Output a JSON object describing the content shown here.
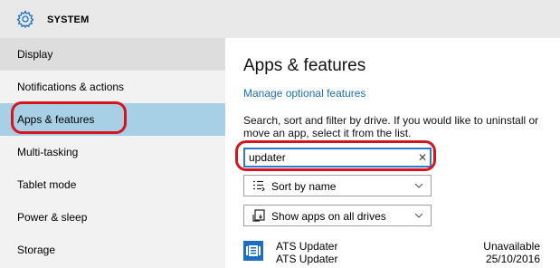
{
  "header": {
    "title": "SYSTEM",
    "icon": "gear-icon"
  },
  "sidebar": {
    "items": [
      {
        "label": "Display",
        "state": "hover"
      },
      {
        "label": "Notifications & actions",
        "state": "normal"
      },
      {
        "label": "Apps & features",
        "state": "selected"
      },
      {
        "label": "Multi-tasking",
        "state": "normal"
      },
      {
        "label": "Tablet mode",
        "state": "normal"
      },
      {
        "label": "Power & sleep",
        "state": "normal"
      },
      {
        "label": "Storage",
        "state": "normal"
      }
    ]
  },
  "main": {
    "heading": "Apps & features",
    "manage_link": "Manage optional features",
    "description": "Search, sort and filter by drive. If you would like to uninstall or move an app, select it from the list.",
    "search": {
      "value": "updater",
      "clear_icon": "close-icon"
    },
    "sort_dropdown": {
      "label": "Sort by name",
      "icon": "sort-icon"
    },
    "drive_dropdown": {
      "label": "Show apps on all drives",
      "icon": "drive-icon"
    },
    "apps": [
      {
        "name": "ATS Updater",
        "publisher": "ATS Updater",
        "size": "Unavailable",
        "date": "25/10/2016"
      }
    ]
  },
  "colors": {
    "accent": "#1d6fbf",
    "highlight": "#a7cfe6",
    "annotation": "#d9131b"
  }
}
